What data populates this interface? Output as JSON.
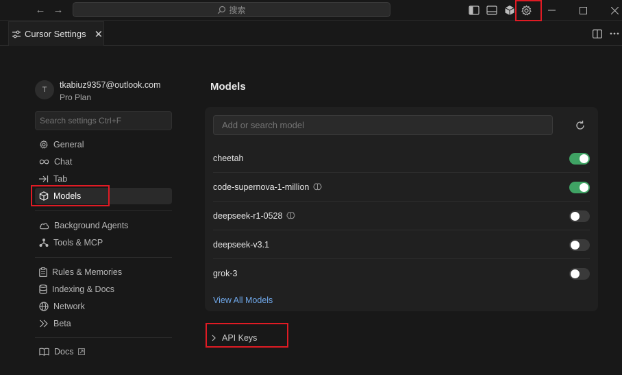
{
  "titlebar": {
    "search_text": "搜索",
    "back_icon": "arrow-left-icon",
    "forward_icon": "arrow-right-icon",
    "layout_icons": [
      "sidebar-toggle-icon",
      "panel-toggle-icon",
      "cube-icon",
      "gear-icon"
    ],
    "window_controls": [
      "minimize-icon",
      "maximize-icon",
      "close-icon"
    ]
  },
  "tab": {
    "label": "Cursor Settings",
    "icon": "settings-sliders-icon",
    "close": "✕"
  },
  "tabbar_actions": [
    "split-editor-icon",
    "more-icon"
  ],
  "account": {
    "initial": "T",
    "email": "tkabiuz9357@outlook.com",
    "plan": "Pro Plan"
  },
  "sidebar": {
    "search_placeholder": "Search settings Ctrl+F",
    "groups": [
      [
        {
          "label": "General",
          "icon": "gear-icon"
        },
        {
          "label": "Chat",
          "icon": "infinity-icon"
        },
        {
          "label": "Tab",
          "icon": "tab-arrow-icon"
        },
        {
          "label": "Models",
          "icon": "cube-icon",
          "active": true
        }
      ],
      [
        {
          "label": "Background Agents",
          "icon": "cloud-icon"
        },
        {
          "label": "Tools & MCP",
          "icon": "tools-icon"
        }
      ],
      [
        {
          "label": "Rules & Memories",
          "icon": "clipboard-icon"
        },
        {
          "label": "Indexing & Docs",
          "icon": "database-icon"
        },
        {
          "label": "Network",
          "icon": "globe-icon"
        },
        {
          "label": "Beta",
          "icon": "chevrons-right-icon"
        }
      ],
      [
        {
          "label": "Docs",
          "icon": "book-icon",
          "external": true
        }
      ]
    ]
  },
  "main": {
    "title": "Models",
    "search_placeholder": "Add or search model",
    "models": [
      {
        "name": "cheetah",
        "enabled": true,
        "thinking": false
      },
      {
        "name": "code-supernova-1-million",
        "enabled": true,
        "thinking": true
      },
      {
        "name": "deepseek-r1-0528",
        "enabled": false,
        "thinking": true
      },
      {
        "name": "deepseek-v3.1",
        "enabled": false,
        "thinking": false
      },
      {
        "name": "grok-3",
        "enabled": false,
        "thinking": false
      }
    ],
    "view_all": "View All Models",
    "api_keys": "API Keys"
  },
  "colors": {
    "accent_link": "#6fa7e8",
    "toggle_on": "#3fa364",
    "highlight_box": "#e01b24"
  }
}
